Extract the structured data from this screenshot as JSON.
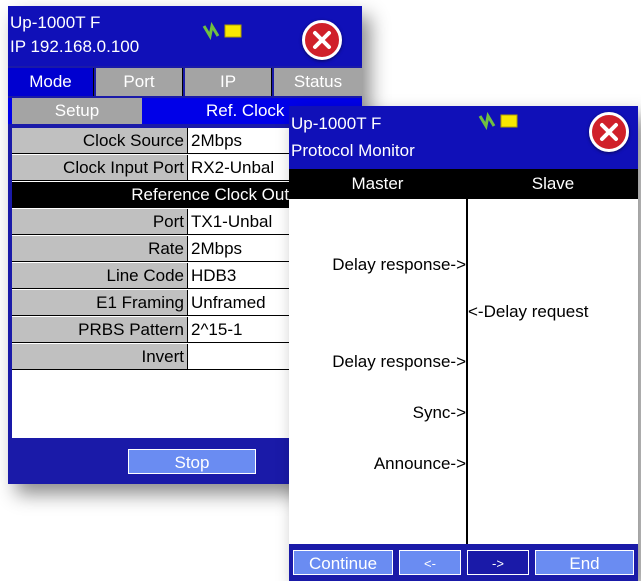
{
  "settings_window": {
    "title": "Up-1000T F",
    "subtitle": "IP 192.168.0.100",
    "tabs": [
      {
        "label": "Mode"
      },
      {
        "label": "Port"
      },
      {
        "label": "IP"
      },
      {
        "label": "Status"
      }
    ],
    "subtabs": [
      {
        "label": "Setup"
      },
      {
        "label": "Ref. Clock"
      }
    ],
    "rows": [
      {
        "label": "Clock Source",
        "value": "2Mbps"
      },
      {
        "label": "Clock Input Port",
        "value": "RX2-Unbal"
      }
    ],
    "section_header": "Reference Clock Output",
    "output_rows": [
      {
        "label": "Port",
        "value": "TX1-Unbal"
      },
      {
        "label": "Rate",
        "value": "2Mbps"
      },
      {
        "label": "Line Code",
        "value": "HDB3"
      },
      {
        "label": "E1 Framing",
        "value": "Unframed"
      },
      {
        "label": "PRBS Pattern",
        "value": "2^15-1"
      }
    ],
    "invert_label": "Invert",
    "invert_checked": false,
    "stop_label": "Stop"
  },
  "monitor_window": {
    "title": "Up-1000T F",
    "subtitle": "Protocol Monitor",
    "master_header": "Master",
    "slave_header": "Slave",
    "messages": [
      {
        "side": "master",
        "text": "Delay response->"
      },
      {
        "side": "slave",
        "text": "<-Delay request"
      },
      {
        "side": "master",
        "text": "Delay response->"
      },
      {
        "side": "master",
        "text": "Sync->"
      },
      {
        "side": "master",
        "text": "Announce->"
      }
    ],
    "buttons": {
      "continue": "Continue",
      "prev": "<-",
      "next": "->",
      "end": "End"
    }
  },
  "colors": {
    "titlebar": "#1010b8",
    "button": "#6a8cf2",
    "close": "#d0202a"
  }
}
